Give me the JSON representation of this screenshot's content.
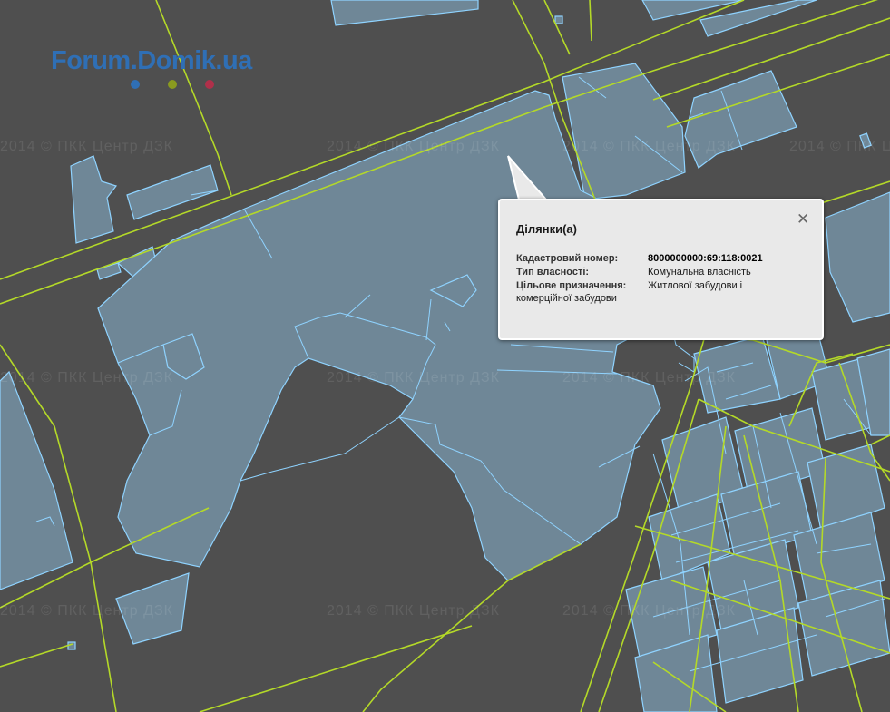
{
  "logo": {
    "text": "Forum.Domik.ua",
    "dot_colors": [
      "#2f6fb5",
      "#8a9a1f",
      "#b0304a"
    ]
  },
  "watermark": {
    "text": "2014 © ПКК  Центр ДЗК"
  },
  "map": {
    "background_color": "#4f4f4f",
    "parcel_fill": "#6f8797",
    "parcel_stroke": "#8fd3ff",
    "road_color": "#b4d928"
  },
  "popup": {
    "title": "Ділянки(а)",
    "close_icon": "close-icon",
    "fields": [
      {
        "label": "Кадастровий номер:",
        "value": "8000000000:69:118:0021"
      },
      {
        "label": "Тип власності:",
        "value": "Комунальна власність"
      },
      {
        "label": "Цільове призначення:",
        "value": "Житлової забудови і"
      }
    ],
    "purpose_wrap": "комерційної забудови"
  }
}
